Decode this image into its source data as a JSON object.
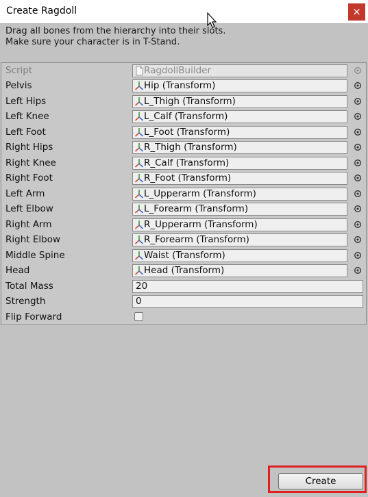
{
  "window": {
    "title": "Create Ragdoll",
    "close_glyph": "×"
  },
  "info": {
    "line1": "Drag all bones from the hierarchy into their slots.",
    "line2": "Make sure your character is in T-Stand."
  },
  "script_row": {
    "label": "Script",
    "value": "RagdollBuilder",
    "icon": "script-file-icon"
  },
  "bones": [
    {
      "label": "Pelvis",
      "value": "Hip (Transform)"
    },
    {
      "label": "Left Hips",
      "value": "L_Thigh (Transform)"
    },
    {
      "label": "Left Knee",
      "value": "L_Calf (Transform)"
    },
    {
      "label": "Left Foot",
      "value": "L_Foot (Transform)"
    },
    {
      "label": "Right Hips",
      "value": "R_Thigh (Transform)"
    },
    {
      "label": "Right Knee",
      "value": "R_Calf (Transform)"
    },
    {
      "label": "Right Foot",
      "value": "R_Foot (Transform)"
    },
    {
      "label": "Left Arm",
      "value": "L_Upperarm (Transform)"
    },
    {
      "label": "Left Elbow",
      "value": "L_Forearm (Transform)"
    },
    {
      "label": "Right Arm",
      "value": "R_Upperarm (Transform)"
    },
    {
      "label": "Right Elbow",
      "value": "R_Forearm (Transform)"
    },
    {
      "label": "Middle Spine",
      "value": "Waist (Transform)"
    },
    {
      "label": "Head",
      "value": "Head (Transform)"
    }
  ],
  "total_mass": {
    "label": "Total Mass",
    "value": "20"
  },
  "strength": {
    "label": "Strength",
    "value": "0"
  },
  "flip_forward": {
    "label": "Flip Forward",
    "checked": false
  },
  "create_button": {
    "label": "Create"
  },
  "colors": {
    "close": "#c0392b",
    "highlight": "#e02020",
    "background": "#c2c2c2"
  }
}
